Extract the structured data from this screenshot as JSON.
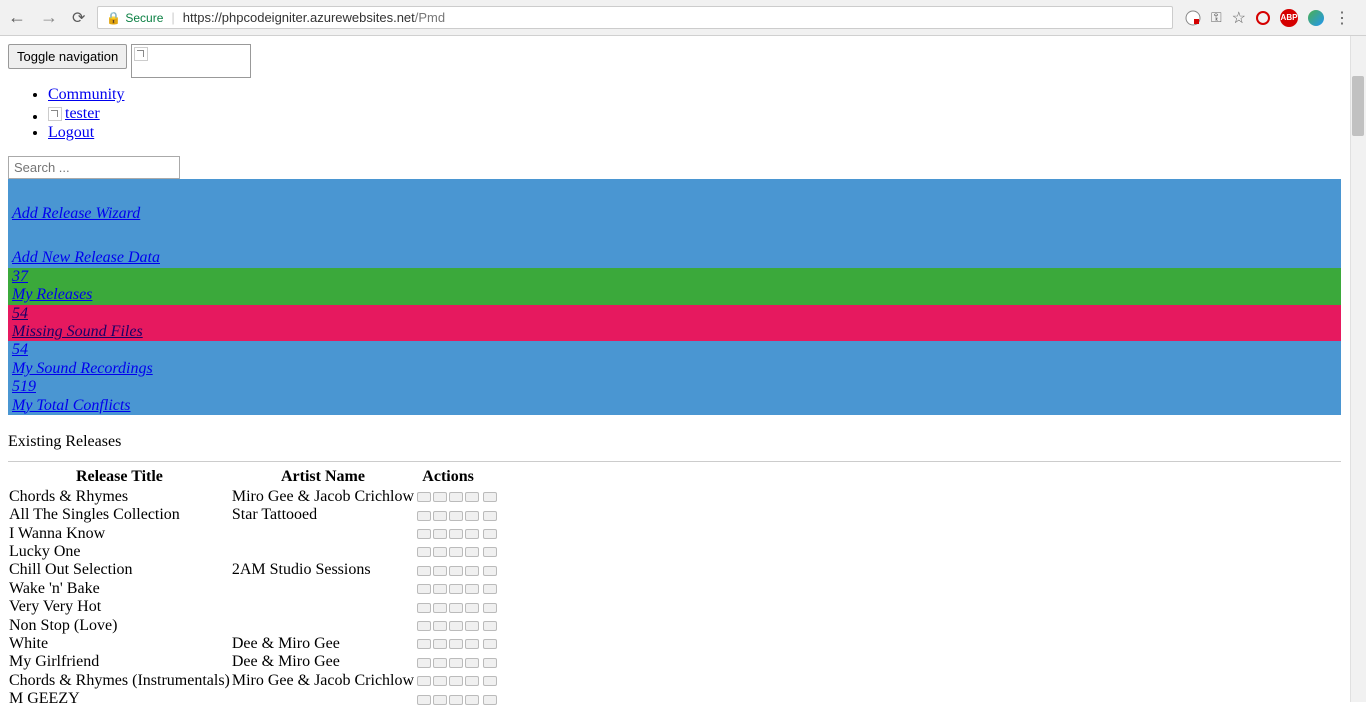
{
  "browser": {
    "secure_label": "Secure",
    "url_host": "https://phpcodeigniter.azurewebsites.net",
    "url_path": "/Pmd",
    "abp_label": "ABP"
  },
  "header": {
    "toggle_label": "Toggle navigation"
  },
  "nav": {
    "community": "Community",
    "tester": "tester",
    "logout": "Logout"
  },
  "search": {
    "placeholder": "Search ..."
  },
  "stats": [
    {
      "label": "Add Release Wizard",
      "count": "",
      "color": "blue",
      "spacer": true
    },
    {
      "label": "Add New Release Data",
      "count": "",
      "color": "blue",
      "spacer": true
    },
    {
      "label": "My Releases",
      "count": "37",
      "color": "green",
      "spacer": false
    },
    {
      "label": "Missing Sound Files",
      "count": "54",
      "color": "pink",
      "spacer": false
    },
    {
      "label": "My Sound Recordings",
      "count": "54",
      "color": "blue",
      "spacer": false
    },
    {
      "label": "My Total Conflicts",
      "count": "519",
      "color": "blue",
      "spacer": false
    }
  ],
  "table": {
    "section_title": "Existing Releases",
    "headers": {
      "title": "Release Title",
      "artist": "Artist Name",
      "actions": "Actions"
    },
    "rows": [
      {
        "title": "Chords & Rhymes",
        "artist": "Miro Gee & Jacob Crichlow"
      },
      {
        "title": "All The Singles Collection",
        "artist": "Star Tattooed"
      },
      {
        "title": "I Wanna Know",
        "artist": ""
      },
      {
        "title": "Lucky One",
        "artist": ""
      },
      {
        "title": "Chill Out Selection",
        "artist": "2AM Studio Sessions"
      },
      {
        "title": "Wake 'n' Bake",
        "artist": ""
      },
      {
        "title": "Very Very Hot",
        "artist": ""
      },
      {
        "title": "Non Stop (Love)",
        "artist": ""
      },
      {
        "title": "White",
        "artist": "Dee & Miro Gee"
      },
      {
        "title": "My Girlfriend",
        "artist": "Dee & Miro Gee"
      },
      {
        "title": "Chords & Rhymes (Instrumentals)",
        "artist": "Miro Gee & Jacob Crichlow"
      },
      {
        "title": "M GEEZY",
        "artist": ""
      }
    ]
  }
}
